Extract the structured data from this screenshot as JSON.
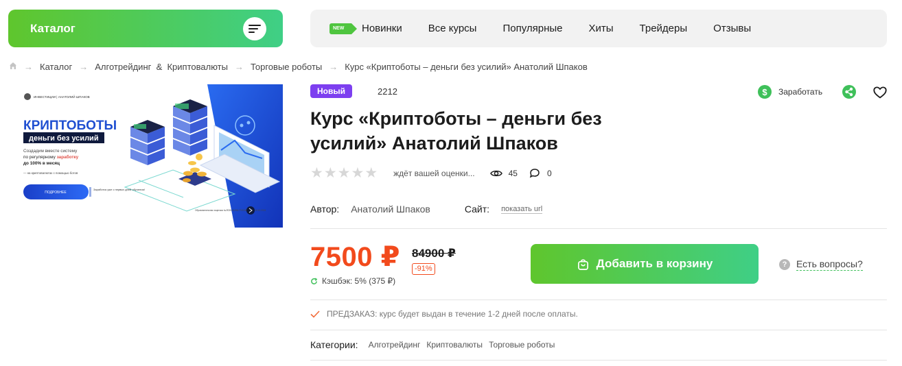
{
  "header": {
    "catalog_label": "Каталог",
    "new_flag": "NEW",
    "nav": [
      "Новинки",
      "Все курсы",
      "Популярные",
      "Хиты",
      "Трейдеры",
      "Отзывы"
    ]
  },
  "breadcrumb": {
    "items": [
      "Каталог",
      "Алготрейдинг  &  Криптовалюты",
      "Торговые роботы"
    ],
    "current": "Курс «Криптоботы – деньги без усилий» Анатолий Шпаков"
  },
  "banner": {
    "author_line": "ИНВЕСТИЦИИ | АНАТОЛИЙ ШПАКОВ",
    "headline": "КРИПТОБОТЫ",
    "subheadline": "деньги без усилий",
    "desc_line1": "Создадим вместе систему",
    "desc_line2a": "по регулярному ",
    "desc_line2b": "заработку",
    "desc_line3": "до 100% в месяц",
    "desc_line4": "— на криптовалютах с помощью ботов",
    "button": "ПОДРОБНЕЕ",
    "note": "Заработок уже с первых дней обучения!",
    "fine_print": "Образовательная лицензия №Л035-01298-77/01368635 от 30.10.2024"
  },
  "product": {
    "badge": "Новый",
    "sku": "2212",
    "earn_label": "Заработать",
    "title": "Курс «Криптоботы – деньги без усилий» Анатолий Шпаков",
    "rating_value": 0,
    "rating_max": 5,
    "rating_text": "ждёт вашей оценки...",
    "views": "45",
    "comments": "0",
    "author_label": "Автор:",
    "author_value": "Анатолий Шпаков",
    "site_label": "Сайт:",
    "site_link": "показать url",
    "price": "7500 ₽",
    "old_price": "84900 ₽",
    "discount": "-91%",
    "cashback": "Кэшбэк: 5% (375 ₽)",
    "add_to_cart": "Добавить в корзину",
    "questions": "Есть вопросы?",
    "preorder": "ПРЕДЗАКАЗ: курс будет выдан в течение 1-2 дней после оплаты.",
    "categories_label": "Категории:",
    "categories": [
      "Алготрейдинг",
      "Криптовалюты",
      "Торговые роботы"
    ]
  },
  "colors": {
    "accent_green": "#4fc53f",
    "price_red": "#f24a1c",
    "badge_purple": "#7d3ff0",
    "banner_blue": "#1b4fd8"
  }
}
